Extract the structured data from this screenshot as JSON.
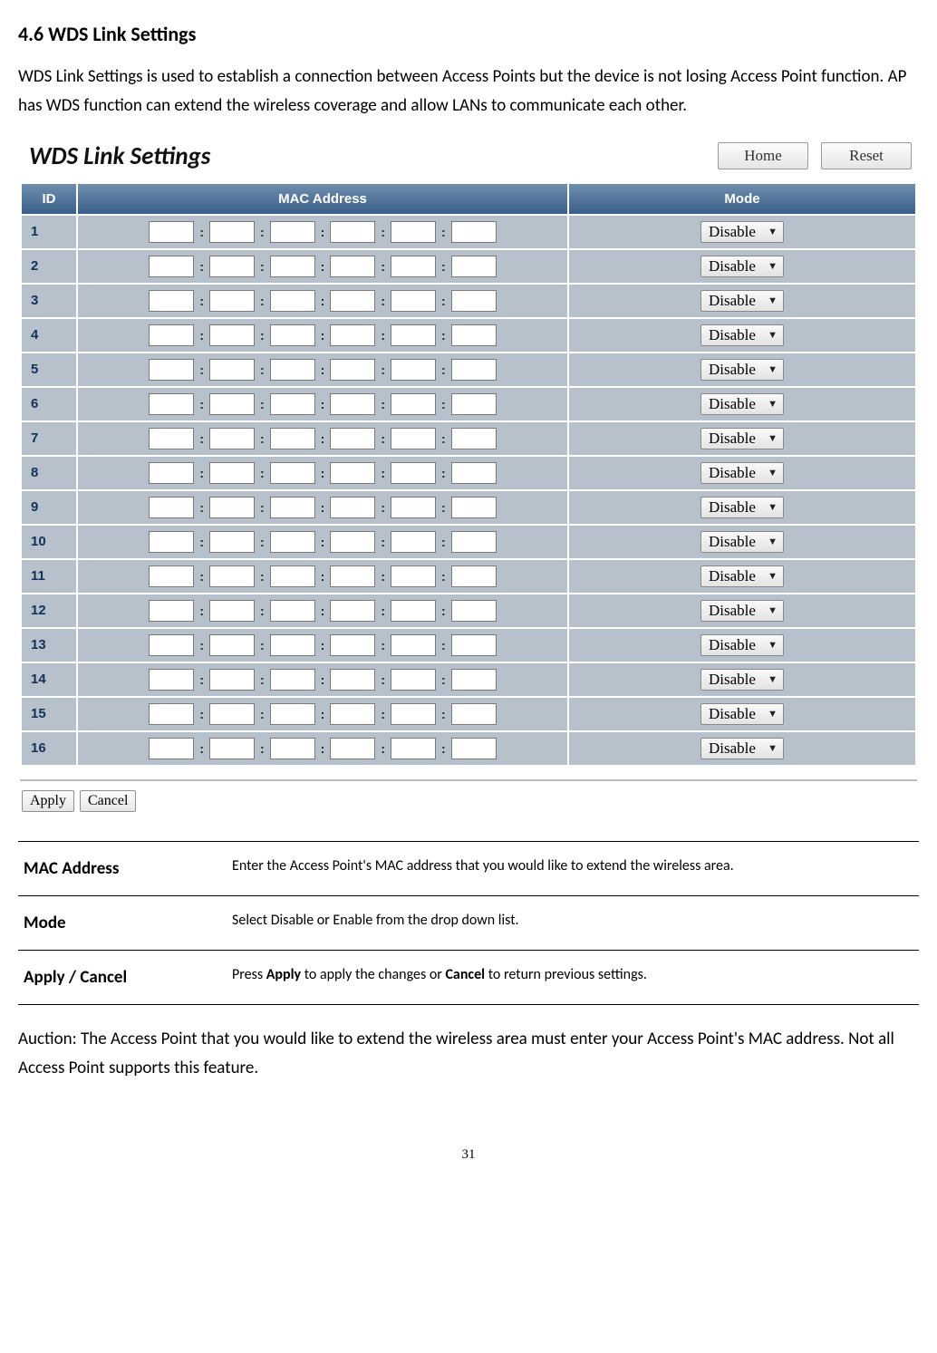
{
  "heading": "4.6 WDS Link Settings",
  "intro": "WDS Link Settings is used to establish a connection between Access Points but the device is not losing Access Point function. AP has WDS function can extend the wireless coverage and allow LANs to communicate each other.",
  "panel": {
    "title": "WDS Link Settings",
    "buttons": {
      "home": "Home",
      "reset": "Reset"
    },
    "columns": {
      "id": "ID",
      "mac": "MAC Address",
      "mode": "Mode"
    },
    "rows": [
      {
        "id": "1",
        "mac": [
          "",
          "",
          "",
          "",
          "",
          ""
        ],
        "mode": "Disable"
      },
      {
        "id": "2",
        "mac": [
          "",
          "",
          "",
          "",
          "",
          ""
        ],
        "mode": "Disable"
      },
      {
        "id": "3",
        "mac": [
          "",
          "",
          "",
          "",
          "",
          ""
        ],
        "mode": "Disable"
      },
      {
        "id": "4",
        "mac": [
          "",
          "",
          "",
          "",
          "",
          ""
        ],
        "mode": "Disable"
      },
      {
        "id": "5",
        "mac": [
          "",
          "",
          "",
          "",
          "",
          ""
        ],
        "mode": "Disable"
      },
      {
        "id": "6",
        "mac": [
          "",
          "",
          "",
          "",
          "",
          ""
        ],
        "mode": "Disable"
      },
      {
        "id": "7",
        "mac": [
          "",
          "",
          "",
          "",
          "",
          ""
        ],
        "mode": "Disable"
      },
      {
        "id": "8",
        "mac": [
          "",
          "",
          "",
          "",
          "",
          ""
        ],
        "mode": "Disable"
      },
      {
        "id": "9",
        "mac": [
          "",
          "",
          "",
          "",
          "",
          ""
        ],
        "mode": "Disable"
      },
      {
        "id": "10",
        "mac": [
          "",
          "",
          "",
          "",
          "",
          ""
        ],
        "mode": "Disable"
      },
      {
        "id": "11",
        "mac": [
          "",
          "",
          "",
          "",
          "",
          ""
        ],
        "mode": "Disable"
      },
      {
        "id": "12",
        "mac": [
          "",
          "",
          "",
          "",
          "",
          ""
        ],
        "mode": "Disable"
      },
      {
        "id": "13",
        "mac": [
          "",
          "",
          "",
          "",
          "",
          ""
        ],
        "mode": "Disable"
      },
      {
        "id": "14",
        "mac": [
          "",
          "",
          "",
          "",
          "",
          ""
        ],
        "mode": "Disable"
      },
      {
        "id": "15",
        "mac": [
          "",
          "",
          "",
          "",
          "",
          ""
        ],
        "mode": "Disable"
      },
      {
        "id": "16",
        "mac": [
          "",
          "",
          "",
          "",
          "",
          ""
        ],
        "mode": "Disable"
      }
    ],
    "apply": "Apply",
    "cancel": "Cancel"
  },
  "desc": {
    "mac_key": "MAC Address",
    "mac_val": "Enter the Access Point's MAC address that you would like to extend the wireless area.",
    "mode_key": "Mode",
    "mode_val": "Select Disable or Enable from the drop down list.",
    "ac_key": "Apply / Cancel",
    "ac_prefix": "Press ",
    "ac_apply": "Apply",
    "ac_mid": " to apply the changes or ",
    "ac_cancel": "Cancel",
    "ac_suffix": " to return previous settings."
  },
  "footer_note": "Auction: The Access Point that you would like to extend the wireless area must enter your Access Point's MAC address. Not all Access Point supports this feature.",
  "page_number": "31"
}
